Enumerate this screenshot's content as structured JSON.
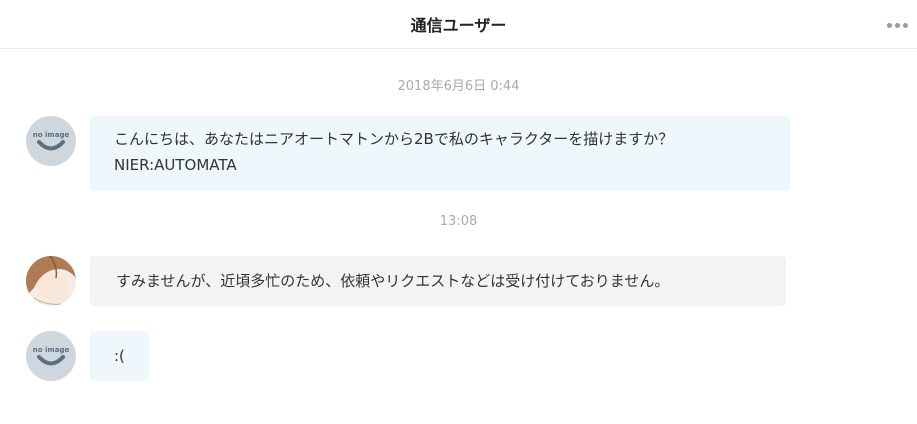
{
  "header": {
    "title": "通信ユーザー",
    "more_icon": "more-horizontal-icon"
  },
  "thread": {
    "timestamps": [
      "2018年6月6日 0:44",
      "13:08"
    ],
    "messages": [
      {
        "sender": "other",
        "avatar": "no-image-avatar",
        "avatar_text": "no image",
        "lines": [
          "こんにちは、あなたはニアオートマトンから2Bで私のキャラクターを描けますか？",
          "NIER:AUTOMATA"
        ]
      },
      {
        "sender": "self",
        "avatar": "anime-character-avatar",
        "lines": [
          "すみませんが、近頃多忙のため、依頼やリクエストなどは受け付けておりません。"
        ]
      },
      {
        "sender": "other",
        "avatar": "no-image-avatar",
        "avatar_text": "no image",
        "lines": [
          ":("
        ]
      }
    ]
  },
  "colors": {
    "incoming_bubble": "#eef7fb",
    "outgoing_bubble": "#f3f3f3",
    "timestamp_text": "#aaaaaa",
    "no_image_avatar_bg": "#cfd7de"
  }
}
